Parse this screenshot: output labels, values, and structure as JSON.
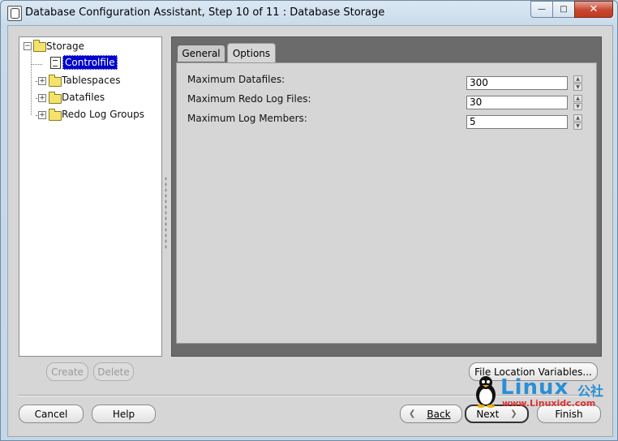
{
  "window": {
    "title": "Database Configuration Assistant, Step 10 of 11 : Database Storage",
    "close_glyph": "✕",
    "max_glyph": "□",
    "min_glyph": "—"
  },
  "tree": {
    "root": "Storage",
    "items": [
      {
        "label": "Controlfile",
        "selected": true
      },
      {
        "label": "Tablespaces"
      },
      {
        "label": "Datafiles"
      },
      {
        "label": "Redo Log Groups"
      }
    ],
    "expand_glyph": "+",
    "collapse_glyph": "−"
  },
  "tabs": [
    {
      "label": "General"
    },
    {
      "label": "Options",
      "active": true
    }
  ],
  "options": {
    "fields": [
      {
        "label": "Maximum Datafiles:",
        "value": "300"
      },
      {
        "label": "Maximum Redo Log Files:",
        "value": "30"
      },
      {
        "label": "Maximum Log Members:",
        "value": "5"
      }
    ]
  },
  "buttons": {
    "create": "Create",
    "delete": "Delete",
    "file_location": "File Location Variables...",
    "cancel": "Cancel",
    "help": "Help",
    "back": "Back",
    "next": "Next",
    "finish": "Finish"
  },
  "watermark": {
    "brand": "Linux",
    "brand_cn": "公社",
    "url": "www.Linuxidc.com"
  }
}
